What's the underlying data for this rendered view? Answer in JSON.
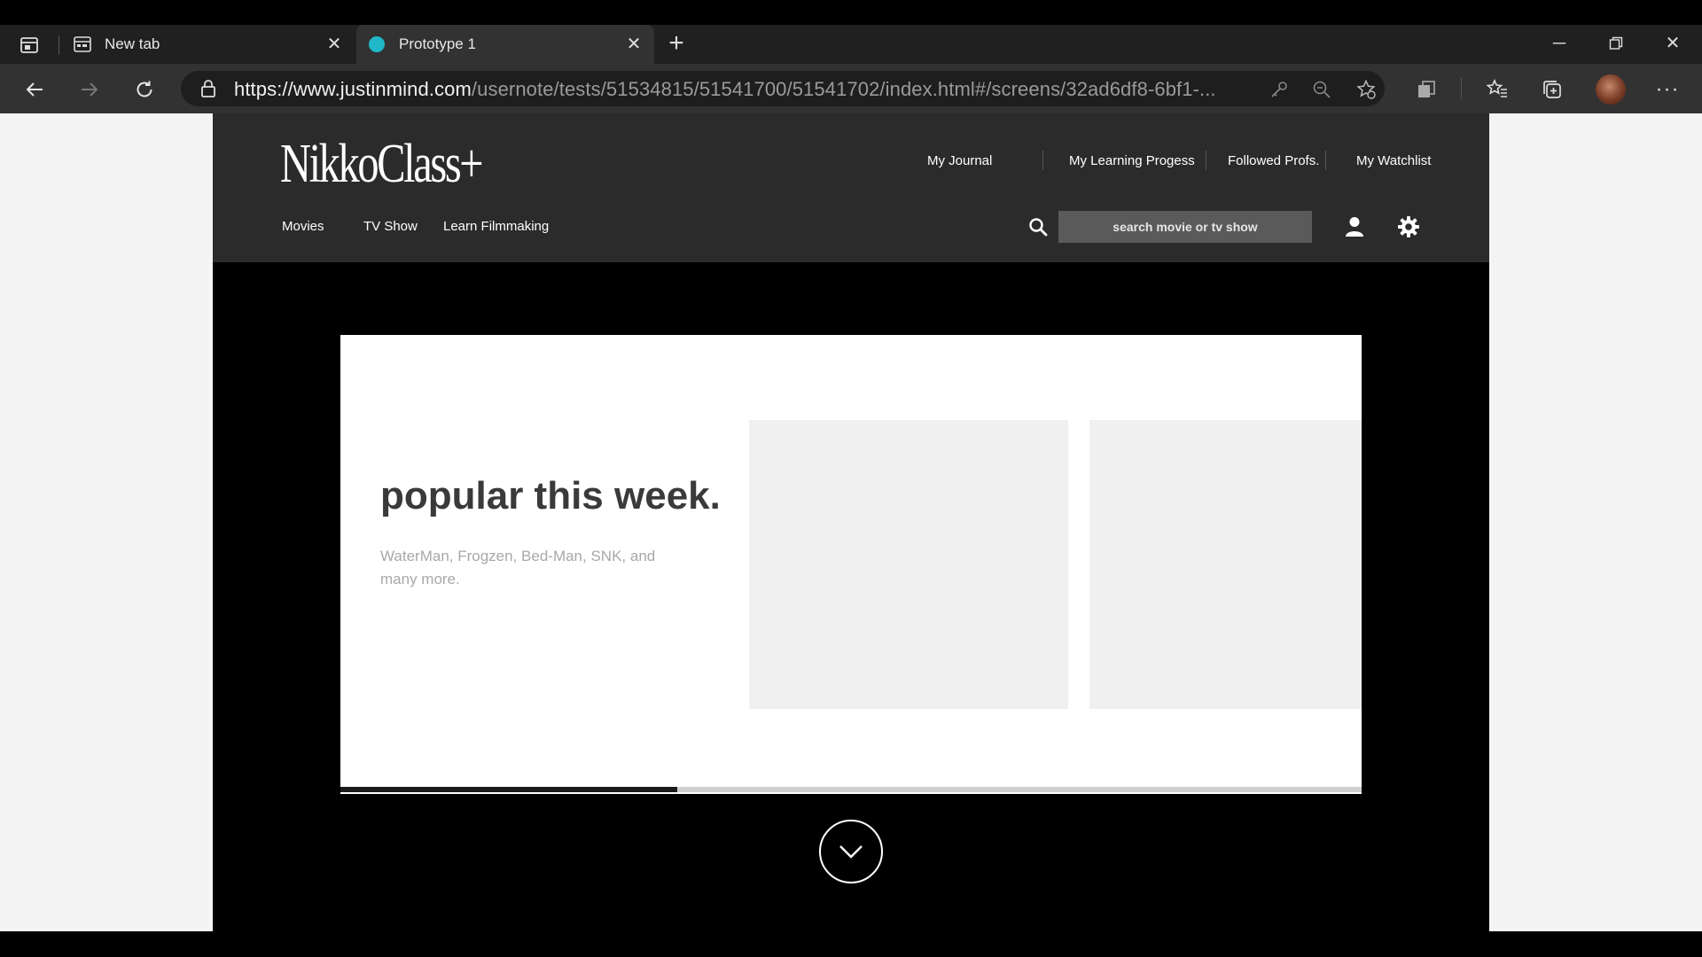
{
  "browser": {
    "tabs": [
      {
        "title": "New tab",
        "active": false
      },
      {
        "title": "Prototype 1",
        "active": true
      }
    ],
    "url": {
      "host": "https://www.justinmind.com",
      "path": "/usernote/tests/51534815/51541700/51541702/index.html#/screens/32ad6df8-6bf1-..."
    },
    "colors": {
      "chrome_dark": "#202020",
      "chrome_toolbar": "#323232",
      "favicon_teal": "#1fb8c9"
    }
  },
  "site": {
    "logo": "NikkoClass+",
    "top_nav": [
      "My Journal",
      "My Learning Progess",
      "Followed Profs.",
      "My Watchlist"
    ],
    "main_nav": [
      "Movies",
      "TV Show",
      "Learn Filmmaking"
    ],
    "search": {
      "placeholder": "search movie or tv show"
    },
    "colors": {
      "header_bg": "#2b2b2b",
      "page_bg": "#000000",
      "search_bg": "#5a5a5a"
    }
  },
  "hero": {
    "title": "popular this week.",
    "subtitle": "WaterMan, Frogzen, Bed-Man, SNK, and many more.",
    "carousel_progress": 0.33
  },
  "icons": [
    "tab-actions-icon",
    "new-tab-favicon",
    "prototype-favicon",
    "close-icon",
    "plus-icon",
    "minimize-icon",
    "restore-icon",
    "back-icon",
    "forward-icon",
    "refresh-icon",
    "lock-icon",
    "key-icon",
    "zoom-out-icon",
    "favorite-add-icon",
    "extension-icon",
    "favorites-icon",
    "collections-icon",
    "more-icon",
    "search-icon",
    "user-icon",
    "gear-icon",
    "chevron-down-icon"
  ]
}
